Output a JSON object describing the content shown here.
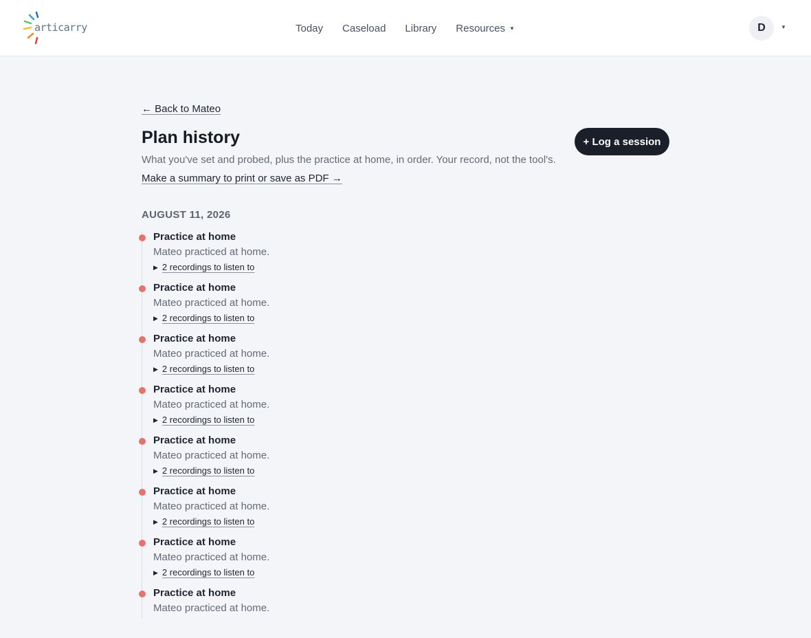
{
  "brand": {
    "name": "articarry",
    "logo_colors": [
      "#3aa0c8",
      "#5cc06a",
      "#f2c230",
      "#ef8a2a",
      "#e0443a",
      "#8e5bb8",
      "#2f6fb0"
    ]
  },
  "nav": {
    "items": [
      {
        "label": "Today"
      },
      {
        "label": "Caseload"
      },
      {
        "label": "Library"
      },
      {
        "label": "Resources",
        "has_dropdown": true
      }
    ]
  },
  "user": {
    "initial": "D",
    "menu_icon": "caret-down-icon"
  },
  "page": {
    "back_link": "← Back to Mateo",
    "title": "Plan history",
    "subtitle": "What you've set and probed, plus the practice at home, in order. Your record, not the tool's.",
    "summary_link": "Make a summary to print or save as PDF →",
    "log_button": "+ Log a session"
  },
  "timeline": {
    "accent_color": "#e5736c",
    "date_heading": "AUGUST 11, 2026",
    "entries": [
      {
        "title": "Practice at home",
        "desc": "Mateo practiced at home.",
        "toggle": "2 recordings to listen to"
      },
      {
        "title": "Practice at home",
        "desc": "Mateo practiced at home.",
        "toggle": "2 recordings to listen to"
      },
      {
        "title": "Practice at home",
        "desc": "Mateo practiced at home.",
        "toggle": "2 recordings to listen to"
      },
      {
        "title": "Practice at home",
        "desc": "Mateo practiced at home.",
        "toggle": "2 recordings to listen to"
      },
      {
        "title": "Practice at home",
        "desc": "Mateo practiced at home.",
        "toggle": "2 recordings to listen to"
      },
      {
        "title": "Practice at home",
        "desc": "Mateo practiced at home.",
        "toggle": "2 recordings to listen to"
      },
      {
        "title": "Practice at home",
        "desc": "Mateo practiced at home.",
        "toggle": "2 recordings to listen to"
      },
      {
        "title": "Practice at home",
        "desc": "Mateo practiced at home.",
        "toggle": ""
      }
    ]
  }
}
